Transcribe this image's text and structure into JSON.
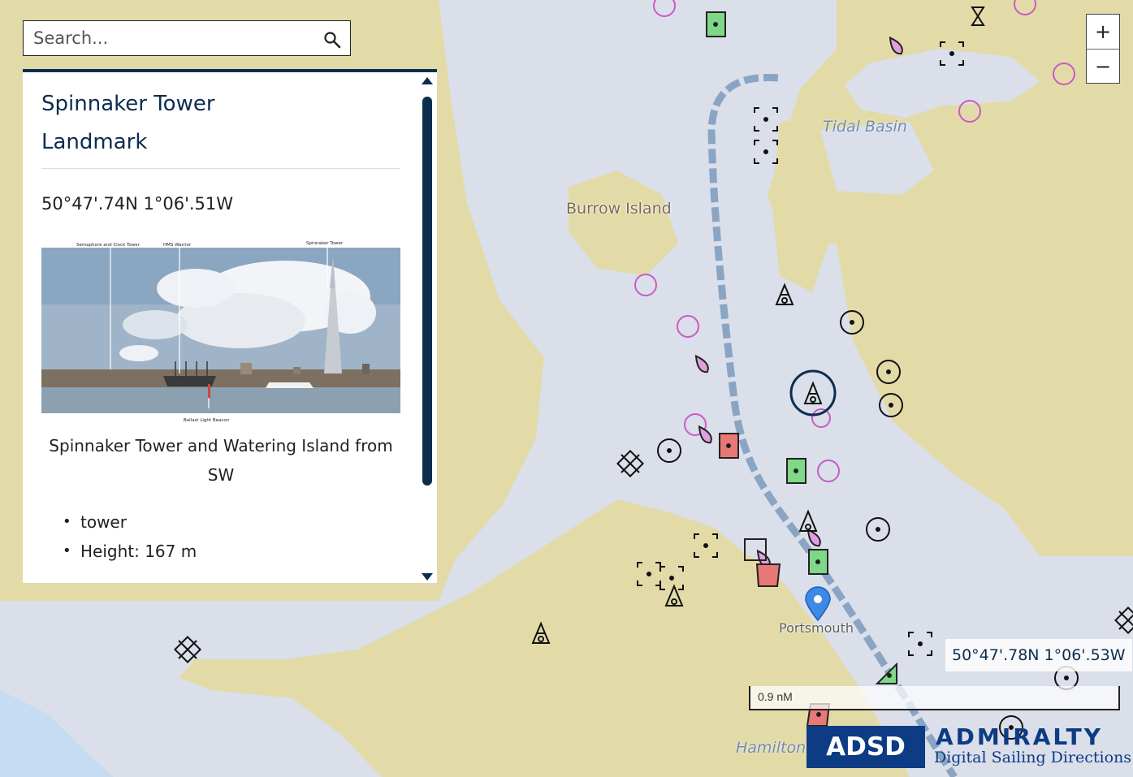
{
  "search": {
    "placeholder": "Search..."
  },
  "panel": {
    "title": "Spinnaker Tower",
    "type": "Landmark",
    "coordinates": "50°47'.74N 1°06'.51W",
    "photo_labels": [
      "Semaphore and Clock Tower",
      "HMS Warrior",
      "Spinnaker Tower",
      "Ballast Light Beacon"
    ],
    "caption": "Spinnaker Tower and Watering Island from SW",
    "facts": [
      "tower",
      "Height: 167 m"
    ]
  },
  "map": {
    "place_labels": {
      "burrow_island": "Burrow Island",
      "tidal_basin": "Tidal Basin",
      "portsmouth": "Portsmouth",
      "hamilton": "Hamilton"
    },
    "cursor_coordinates": "50°47'.78N 1°06'.53W",
    "scale": "0.9 nM",
    "zoom": {
      "in": "+",
      "out": "−"
    }
  },
  "brand": {
    "logo": "ADSD",
    "name": "ADMIRALTY",
    "tagline": "Digital Sailing Directions"
  },
  "colors": {
    "land": "#e2dba8",
    "water": "#dadfea",
    "deep_water": "#c5dcf2",
    "channel": "#8aa5c4",
    "navy": "#0c2d4e",
    "brand": "#0d3b84",
    "magenta": "#c85bc6",
    "buoy_red": "#e87878",
    "buoy_green": "#7ed888"
  },
  "icons": [
    "search-icon",
    "beacon-icon",
    "buoy-icon",
    "wreck-icon",
    "light-flare-icon",
    "location-pin-icon",
    "mooring-icon"
  ]
}
